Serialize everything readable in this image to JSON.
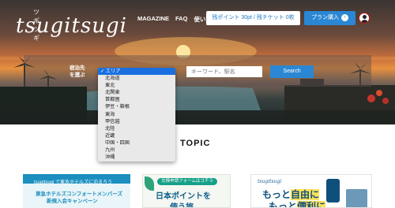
{
  "header": {
    "logo_kana": "ツギツギ",
    "logo_text": "tsugitsugi",
    "nav": [
      "MAGAZINE",
      "FAQ",
      "使い方"
    ],
    "points_label": "残ポイント 30pt / 残チケット 0枚",
    "plan_label": "プラン購入",
    "plan_chevron": "›"
  },
  "search": {
    "label_line1": "宿泊先",
    "label_line2": "を選ぶ",
    "keyword_placeholder": "キーワード、駅名",
    "button_label": "Search",
    "area_options": [
      "✓ エリア",
      "北海道",
      "東北",
      "北関東",
      "首都圏",
      "伊豆・箱根",
      "東海",
      "甲信越",
      "北陸",
      "近畿",
      "中国・四国",
      "九州",
      "沖縄"
    ]
  },
  "topic": {
    "heading": "TOPIC"
  },
  "cards": {
    "card1": {
      "line1": "tsugitsugi で東急ホテルズに泊まろう",
      "line2": "東急ホテルズコンフォートメンバーズ",
      "line3": "新規入会キャンペーン"
    },
    "card2": {
      "pill": "交換申請フォームはコチラ",
      "big1": "日本ポイントを",
      "big2": "使う旅"
    },
    "card3": {
      "brand": "tsugitsugi",
      "line1_a": "もっと",
      "line1_b": "自由に",
      "line2_a": "もっと",
      "line2_b": "便利に"
    }
  },
  "colors": {
    "accent": "#2b87d3",
    "dropdown_selected": "#1a6fe0"
  }
}
